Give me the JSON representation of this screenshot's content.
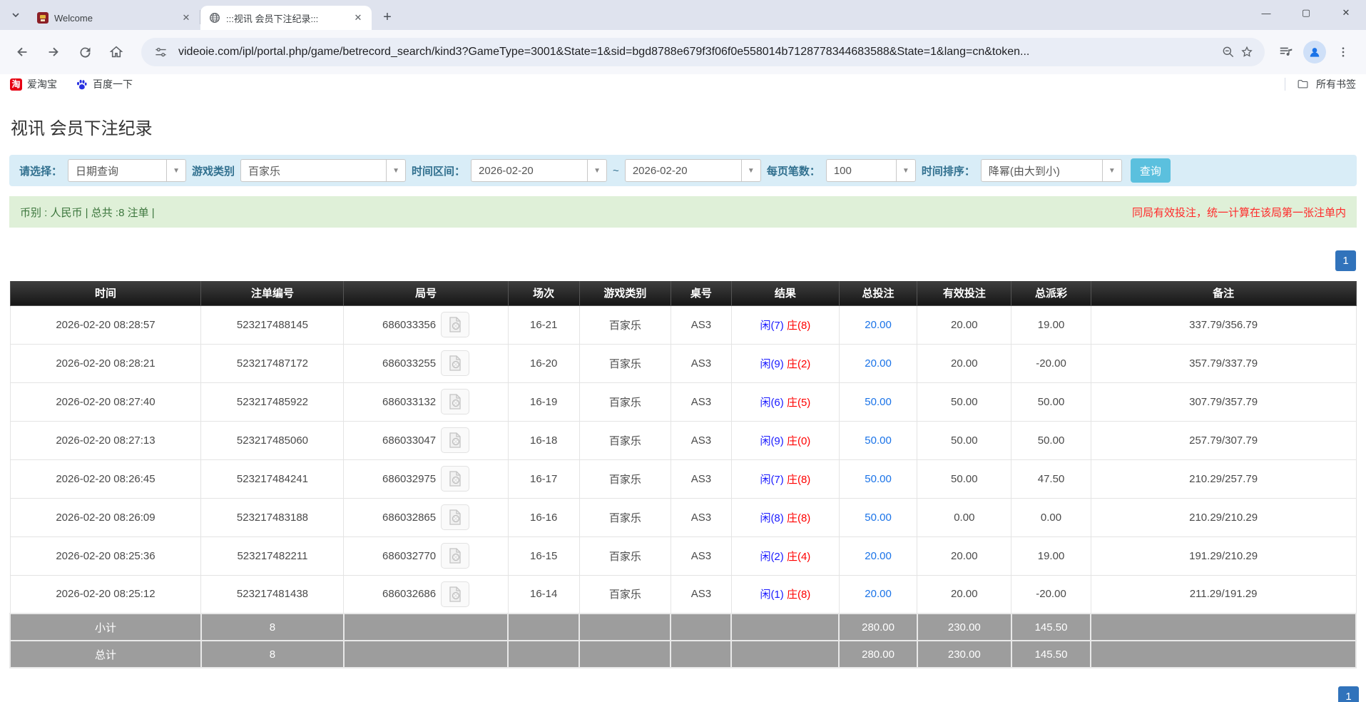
{
  "browser": {
    "tab_search_icon": "v",
    "tabs": [
      {
        "title": "Welcome"
      },
      {
        "title": ":::视讯 会员下注纪录:::"
      }
    ],
    "new_tab_label": "+",
    "window_controls": {
      "minimize": "—",
      "maximize": "▢",
      "close": "✕"
    },
    "url": "videoie.com/ipl/portal.php/game/betrecord_search/kind3?GameType=3001&State=1&sid=bgd8788e679f3f06f0e558014b7128778344683588&State=1&lang=cn&token...",
    "bookmarks": {
      "item1": "爱淘宝",
      "item2": "百度一下",
      "all_bookmarks": "所有书签"
    }
  },
  "page": {
    "title": "视讯 会员下注纪录",
    "filters": {
      "select_label": "请选择：",
      "select_value": "日期查询",
      "game_label": "游戏类别",
      "game_value": "百家乐",
      "range_label": "时间区间：",
      "date_from": "2026-02-20",
      "tilde": "~",
      "date_to": "2026-02-20",
      "per_page_label": "每页笔数：",
      "per_page_value": "100",
      "sort_label": "时间排序：",
      "sort_value": "降幂(由大到小)",
      "query_button": "查询"
    },
    "summary": {
      "left": "币别 : 人民币 | 总共 :8 注单 |",
      "right": "同局有效投注，统一计算在该局第一张注单内"
    },
    "pagination": {
      "current": "1"
    },
    "table": {
      "headers": [
        "时间",
        "注单编号",
        "局号",
        "场次",
        "游戏类别",
        "桌号",
        "结果",
        "总投注",
        "有效投注",
        "总派彩",
        "备注"
      ],
      "rows": [
        {
          "time": "2026-02-20 08:28:57",
          "bet_id": "523217488145",
          "round": "686033356",
          "session": "16-21",
          "game": "百家乐",
          "table_no": "AS3",
          "player": "闲(7)",
          "banker": "庄(8)",
          "total_bet": "20.00",
          "valid_bet": "20.00",
          "payout": "19.00",
          "payout_negative": false,
          "remark": "337.79/356.79"
        },
        {
          "time": "2026-02-20 08:28:21",
          "bet_id": "523217487172",
          "round": "686033255",
          "session": "16-20",
          "game": "百家乐",
          "table_no": "AS3",
          "player": "闲(9)",
          "banker": "庄(2)",
          "total_bet": "20.00",
          "valid_bet": "20.00",
          "payout": "-20.00",
          "payout_negative": true,
          "remark": "357.79/337.79"
        },
        {
          "time": "2026-02-20 08:27:40",
          "bet_id": "523217485922",
          "round": "686033132",
          "session": "16-19",
          "game": "百家乐",
          "table_no": "AS3",
          "player": "闲(6)",
          "banker": "庄(5)",
          "total_bet": "50.00",
          "valid_bet": "50.00",
          "payout": "50.00",
          "payout_negative": false,
          "remark": "307.79/357.79"
        },
        {
          "time": "2026-02-20 08:27:13",
          "bet_id": "523217485060",
          "round": "686033047",
          "session": "16-18",
          "game": "百家乐",
          "table_no": "AS3",
          "player": "闲(9)",
          "banker": "庄(0)",
          "total_bet": "50.00",
          "valid_bet": "50.00",
          "payout": "50.00",
          "payout_negative": false,
          "remark": "257.79/307.79"
        },
        {
          "time": "2026-02-20 08:26:45",
          "bet_id": "523217484241",
          "round": "686032975",
          "session": "16-17",
          "game": "百家乐",
          "table_no": "AS3",
          "player": "闲(7)",
          "banker": "庄(8)",
          "total_bet": "50.00",
          "valid_bet": "50.00",
          "payout": "47.50",
          "payout_negative": false,
          "remark": "210.29/257.79"
        },
        {
          "time": "2026-02-20 08:26:09",
          "bet_id": "523217483188",
          "round": "686032865",
          "session": "16-16",
          "game": "百家乐",
          "table_no": "AS3",
          "player": "闲(8)",
          "banker": "庄(8)",
          "total_bet": "50.00",
          "valid_bet": "0.00",
          "payout": "0.00",
          "payout_negative": false,
          "remark": "210.29/210.29"
        },
        {
          "time": "2026-02-20 08:25:36",
          "bet_id": "523217482211",
          "round": "686032770",
          "session": "16-15",
          "game": "百家乐",
          "table_no": "AS3",
          "player": "闲(2)",
          "banker": "庄(4)",
          "total_bet": "20.00",
          "valid_bet": "20.00",
          "payout": "19.00",
          "payout_negative": false,
          "remark": "191.29/210.29"
        },
        {
          "time": "2026-02-20 08:25:12",
          "bet_id": "523217481438",
          "round": "686032686",
          "session": "16-14",
          "game": "百家乐",
          "table_no": "AS3",
          "player": "闲(1)",
          "banker": "庄(8)",
          "total_bet": "20.00",
          "valid_bet": "20.00",
          "payout": "-20.00",
          "payout_negative": true,
          "remark": "211.29/191.29"
        }
      ],
      "subtotal": {
        "label": "小计",
        "count": "8",
        "total_bet": "280.00",
        "valid_bet": "230.00",
        "payout": "145.50"
      },
      "total": {
        "label": "总计",
        "count": "8",
        "total_bet": "280.00",
        "valid_bet": "230.00",
        "payout": "145.50"
      }
    }
  },
  "colors": {
    "filter_bg": "#d9edf7",
    "filter_label": "#31708f",
    "query_btn": "#5bc0de",
    "summary_bg": "#dff0d8",
    "summary_text": "#3c763d",
    "notice_red": "#ff2a2a",
    "header_bg": "#1a1a1a",
    "footer_bg": "#9d9d9d",
    "pager_blue": "#3173bb",
    "link_blue": "#1a73e8",
    "player_blue": "#1a1aff",
    "banker_red": "#ff0000"
  }
}
